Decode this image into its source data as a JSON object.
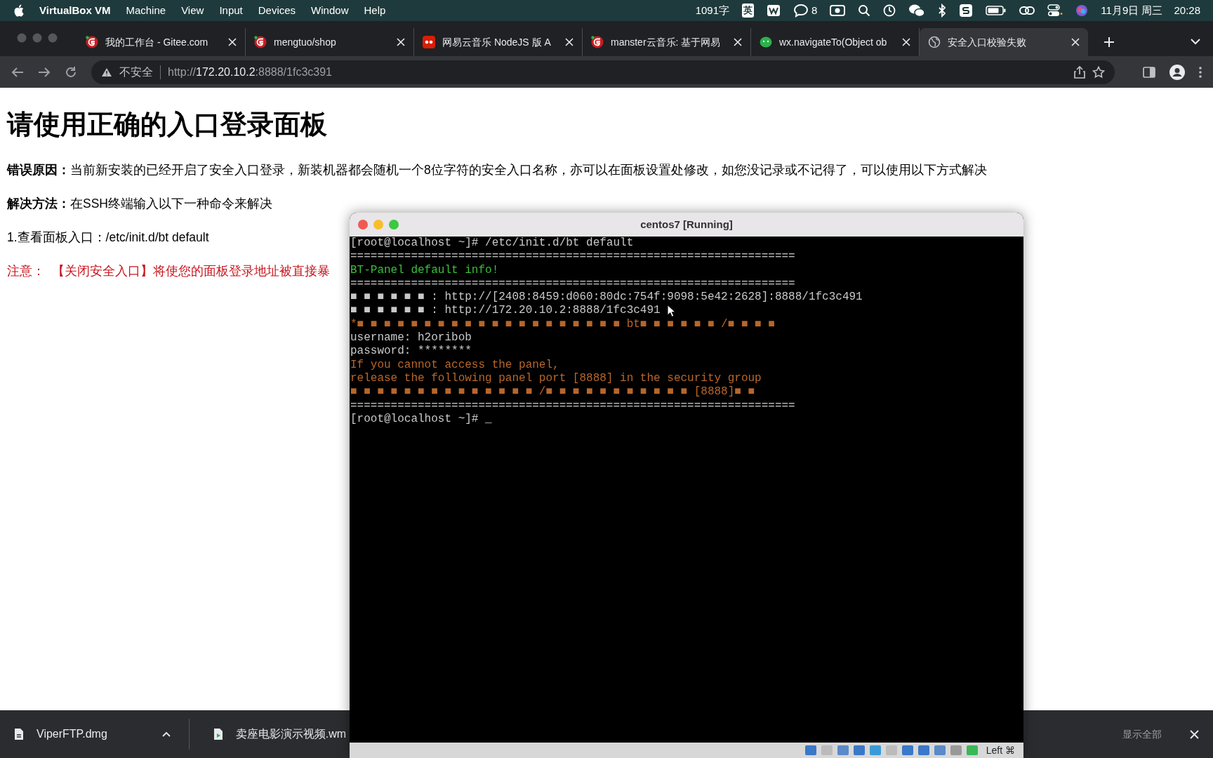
{
  "menubar": {
    "app": "VirtualBox VM",
    "items": [
      "Machine",
      "View",
      "Input",
      "Devices",
      "Window",
      "Help"
    ],
    "word_count": "1091字",
    "input_method": "英",
    "chat_count": "8",
    "date": "11月9日 周三",
    "time": "20:28"
  },
  "tabs": [
    {
      "title": "我的工作台 - Gitee.com",
      "selected": false
    },
    {
      "title": "mengtuo/shop",
      "selected": false
    },
    {
      "title": "网易云音乐 NodeJS 版 A",
      "selected": false
    },
    {
      "title": "manster云音乐: 基于网易",
      "selected": false
    },
    {
      "title": "wx.navigateTo(Object ob",
      "selected": false
    },
    {
      "title": "安全入口校验失败",
      "selected": true
    }
  ],
  "address_bar": {
    "security": "不安全",
    "scheme": "http://",
    "host": "172.20.10.2",
    "path": ":8888/1fc3c391"
  },
  "page": {
    "heading": "请使用正确的入口登录面板",
    "paragraphs": [
      {
        "label": "错误原因：",
        "text": "当前新安装的已经开启了安全入口登录，新装机器都会随机一个8位字符的安全入口名称，亦可以在面板设置处修改，如您没记录或不记得了，可以使用以下方式解决",
        "kind": "normal"
      },
      {
        "label": "解决方法：",
        "text": "在SSH终端输入以下一种命令来解决",
        "kind": "normal"
      },
      {
        "text": "1.查看面板入口：/etc/init.d/bt default",
        "kind": "normal"
      },
      {
        "label": "注意：",
        "text": "【关闭安全入口】将使您的面板登录地址被直接暴",
        "kind": "warning"
      }
    ]
  },
  "vm_window": {
    "title": "centos7 [Running]",
    "terminal_lines": [
      {
        "text": "[root@localhost ~]# /etc/init.d/bt default",
        "kind": "plain"
      },
      {
        "text": "==================================================================",
        "kind": "plain"
      },
      {
        "text": "BT-Panel default info!",
        "kind": "success"
      },
      {
        "text": "==================================================================",
        "kind": "plain"
      },
      {
        "text": "■ ■ ■ ■ ■ ■ : http://[2408:8459:d060:80dc:754f:9098:5e42:2628]:8888/1fc3c491",
        "kind": "plain"
      },
      {
        "text": "■ ■ ■ ■ ■ ■ : http://172.20.10.2:8888/1fc3c491",
        "kind": "plain"
      },
      {
        "text": "*■ ■ ■ ■ ■ ■ ■ ■ ■ ■ ■ ■ ■ ■ ■ ■ ■ ■ ■ ■ bt■ ■ ■ ■ ■ ■ /■ ■ ■ ■",
        "kind": "warning"
      },
      {
        "text": "username: h2oribob",
        "kind": "plain"
      },
      {
        "text": "password: ********",
        "kind": "plain"
      },
      {
        "text": "If you cannot access the panel,",
        "kind": "warning"
      },
      {
        "text": "release the following panel port [8888] in the security group",
        "kind": "warning"
      },
      {
        "text": "■ ■ ■ ■ ■ ■ ■ ■ ■ ■ ■ ■ ■ ■ /■ ■ ■ ■ ■ ■ ■ ■ ■ ■ ■ [8888]■ ■",
        "kind": "warning"
      },
      {
        "text": "==================================================================",
        "kind": "plain"
      },
      {
        "text": "[root@localhost ~]# _",
        "kind": "plain"
      }
    ],
    "host_key": "Left ⌘"
  },
  "downloads": {
    "items": [
      {
        "name": "ViperFTP.dmg",
        "kind": "file"
      },
      {
        "name": "卖座电影演示视频.wm",
        "kind": "video"
      }
    ],
    "show_all": "显示全部"
  }
}
